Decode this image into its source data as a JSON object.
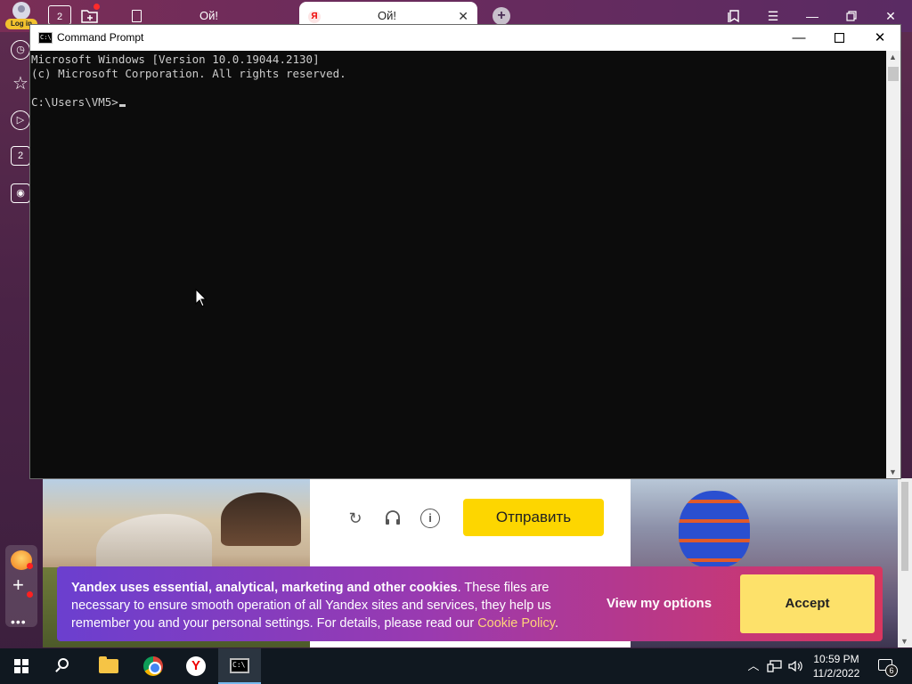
{
  "browser": {
    "login_badge": "Log in",
    "home_badge": "2",
    "tabs": [
      {
        "title": "Ой!"
      },
      {
        "title": "Ой!",
        "favicon": "Я"
      }
    ],
    "sidebar": {
      "collections_count": "2"
    }
  },
  "cmd": {
    "title": "Command Prompt",
    "lines": [
      "Microsoft Windows [Version 10.0.19044.2130]",
      "(c) Microsoft Corporation. All rights reserved.",
      "",
      "C:\\Users\\VM5>"
    ]
  },
  "captcha": {
    "submit_label": "Отправить"
  },
  "cookie_banner": {
    "bold_text": "Yandex uses essential, analytical, marketing and other cookies",
    "body_text": ". These files are necessary to ensure smooth operation of all Yandex sites and services, they help us remember you and your personal settings. For details, please read our ",
    "link_text": "Cookie Policy",
    "end_text": ".",
    "view_options_label": "View my options",
    "accept_label": "Accept"
  },
  "taskbar": {
    "time": "10:59 PM",
    "date": "11/2/2022",
    "notification_count": "6"
  },
  "colors": {
    "accent_yellow": "#fdd600",
    "cookie_gradient_start": "#6b3fcf",
    "cookie_gradient_end": "#d8365f",
    "console_bg": "#0c0c0c",
    "console_text": "#cccccc"
  }
}
